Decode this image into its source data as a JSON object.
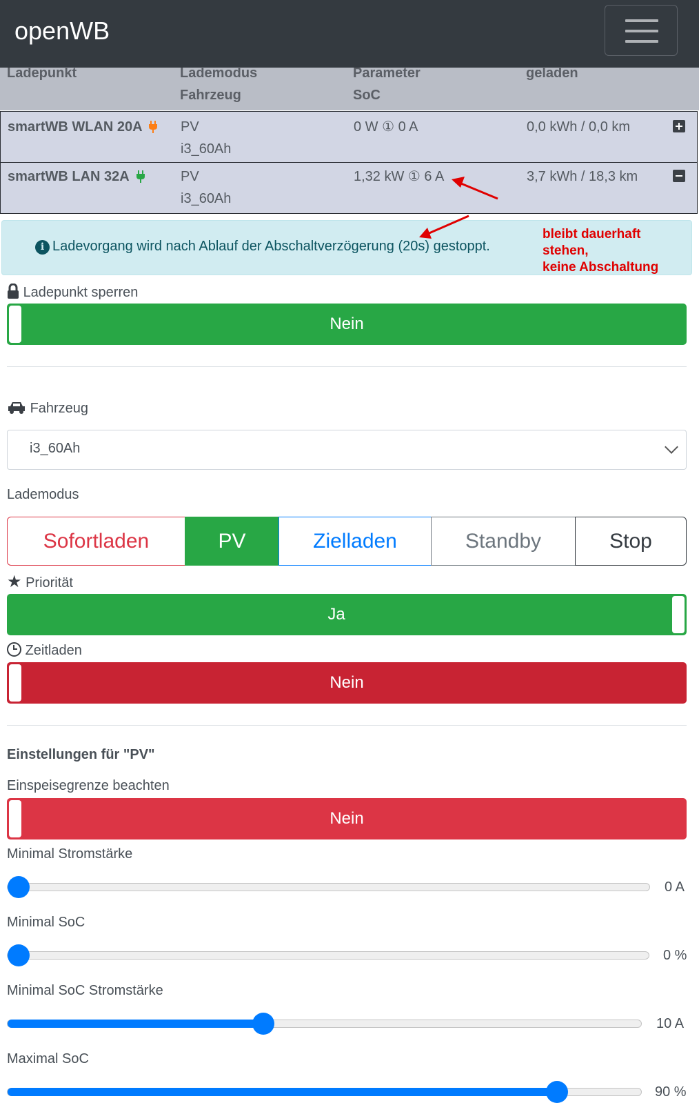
{
  "app": {
    "title": "openWB",
    "menu_icon": "hamburger-icon"
  },
  "table": {
    "headers": {
      "col1": "Ladepunkt",
      "col2a": "Lademodus",
      "col2b": "Fahrzeug",
      "col3a": "Parameter",
      "col3b": "SoC",
      "col4": "geladen"
    },
    "rows": [
      {
        "name": "smartWB WLAN 20A",
        "plug_color": "#fd7e14",
        "mode": "PV",
        "vehicle": "i3_60Ah",
        "params": "0 W ① 0 A",
        "charged": "0,0 kWh / 0,0 km",
        "expand_icon": "plus-square-icon"
      },
      {
        "name": "smartWB LAN 32A",
        "plug_color": "#28a745",
        "mode": "PV",
        "vehicle": "i3_60Ah",
        "params": "1,32 kW ① 6 A",
        "charged": "3,7 kWh / 18,3 km",
        "expand_icon": "minus-square-icon"
      }
    ]
  },
  "alert": {
    "text": "Ladevorgang wird nach Ablauf der Abschaltverzögerung (20s) gestoppt."
  },
  "annotation": {
    "line1": "bleibt dauerhaft",
    "line2": "stehen,",
    "line3": "keine Abschaltung",
    "color": "#e00000"
  },
  "lock": {
    "label": "Ladepunkt sperren",
    "value": "Nein"
  },
  "vehicle": {
    "label": "Fahrzeug",
    "selected": "i3_60Ah"
  },
  "charge_mode": {
    "label": "Lademodus",
    "options": [
      "Sofortladen",
      "PV",
      "Zielladen",
      "Standby",
      "Stop"
    ],
    "active": "PV"
  },
  "priority": {
    "label": "Priorität",
    "value": "Ja"
  },
  "timed": {
    "label": "Zeitladen",
    "value": "Nein"
  },
  "pv_settings": {
    "heading": "Einstellungen für \"PV\"",
    "feed_limit": {
      "label": "Einspeisegrenze beachten",
      "value": "Nein"
    },
    "sliders": [
      {
        "label": "Minimal Stromstärke",
        "value": "0 A",
        "fraction": 0.0
      },
      {
        "label": "Minimal SoC",
        "value": "0 %",
        "fraction": 0.0
      },
      {
        "label": "Minimal SoC Stromstärke",
        "value": "10 A",
        "fraction": 0.4
      },
      {
        "label": "Maximal SoC",
        "value": "90 %",
        "fraction": 0.88
      }
    ]
  },
  "colors": {
    "success": "#28a745",
    "danger": "#dc3545",
    "danger_dark": "#c82333",
    "primary": "#007bff",
    "secondary": "#6c757d"
  }
}
